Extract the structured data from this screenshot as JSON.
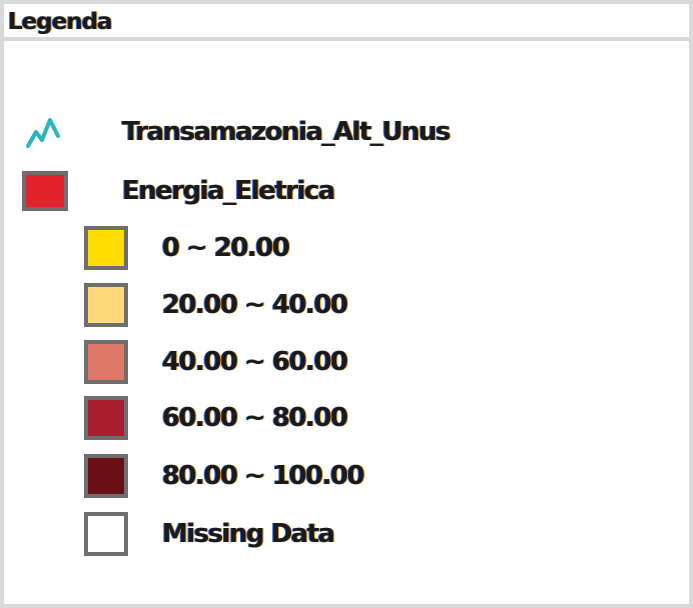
{
  "legend": {
    "title": "Legenda",
    "layers": [
      {
        "label": "Transamazonia_Alt_Unus",
        "icon": "line-layer-icon",
        "color": "#2bb3c0"
      },
      {
        "label": "Energia_Eletrica",
        "icon": "polygon-layer-icon",
        "color": "#e3222b"
      }
    ],
    "classes": [
      {
        "label": "0 ~ 20.00",
        "color": "#ffdd00"
      },
      {
        "label": "20.00 ~ 40.00",
        "color": "#ffd97a"
      },
      {
        "label": "40.00 ~ 60.00",
        "color": "#e07868"
      },
      {
        "label": "60.00 ~ 80.00",
        "color": "#a81e2e"
      },
      {
        "label": "80.00 ~ 100.00",
        "color": "#6a0e16"
      },
      {
        "label": "Missing Data",
        "color": "#ffffff"
      }
    ]
  }
}
